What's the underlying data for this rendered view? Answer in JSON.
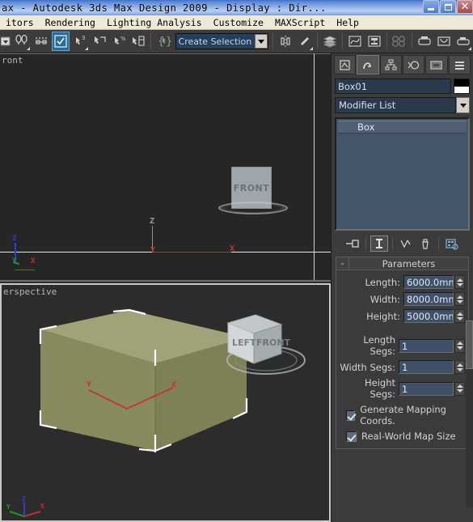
{
  "titlebar": {
    "title": "ax        - Autodesk 3ds Max Design 2009        - Display : Dir...",
    "minimize_label": "Minimize",
    "maximize_label": "Restore",
    "close_label": "Close"
  },
  "menubar": {
    "items": [
      {
        "label": "itors"
      },
      {
        "label": "Rendering"
      },
      {
        "label": "Lighting Analysis"
      },
      {
        "label": "Customize"
      },
      {
        "label": "MAXScript"
      },
      {
        "label": "Help"
      }
    ]
  },
  "toolbar": {
    "selection_set": {
      "value": "Create Selection Set",
      "placeholder": "Create Selection Set"
    },
    "buttons": [
      {
        "name": "undo-dropdown-icon",
        "glyph": "▾"
      },
      {
        "name": "select-and-link-icon",
        "glyph": "⛓"
      },
      {
        "name": "bind-to-space-warp-icon",
        "glyph": "⚙"
      },
      {
        "name": "select-object-icon",
        "glyph": "▣"
      },
      {
        "name": "select-by-name-icon",
        "glyph": "⬚"
      },
      {
        "name": "rectangular-selection-region-icon",
        "glyph": "⬛"
      },
      {
        "name": "window-crossing-icon",
        "glyph": "⬜"
      },
      {
        "name": "select-and-move-icon",
        "glyph": "✥"
      },
      {
        "name": "selection-filter-icon",
        "glyph": "◈"
      },
      {
        "name": "mirror-icon",
        "glyph": "⬌"
      },
      {
        "name": "align-icon",
        "glyph": "⬚"
      },
      {
        "name": "layer-manager-icon",
        "glyph": "☰"
      },
      {
        "name": "curve-editor-icon",
        "glyph": "∿"
      },
      {
        "name": "schematic-view-icon",
        "glyph": "⊞"
      },
      {
        "name": "material-editor-icon",
        "glyph": "◌"
      },
      {
        "name": "render-setup-icon",
        "glyph": "⬛"
      },
      {
        "name": "rendered-frame-window-icon",
        "glyph": "◑"
      },
      {
        "name": "render-production-icon",
        "glyph": "▤"
      }
    ]
  },
  "viewports": {
    "top": {
      "label": "ront",
      "viewcube_face": "FRONT",
      "axis_labels": {
        "z": "Z",
        "y": "Y",
        "x": "X"
      },
      "gizmo_labels": {
        "z": "Z",
        "y": "Y",
        "x": "X"
      }
    },
    "bottom": {
      "label": "erspective",
      "viewcube_faces": {
        "left": "LEFT",
        "front": "FRONT"
      },
      "axis_labels": {
        "z": "Z",
        "y": "Y",
        "x": "X"
      },
      "gizmo_labels": {
        "y": "Y",
        "x": "X"
      },
      "object_color": "#8e9162"
    }
  },
  "command_panel": {
    "tabs": [
      {
        "name": "create-tab",
        "label": "Create"
      },
      {
        "name": "modify-tab",
        "label": "Modify"
      },
      {
        "name": "hierarchy-tab",
        "label": "Hierarchy"
      },
      {
        "name": "motion-tab",
        "label": "Motion"
      },
      {
        "name": "display-tab",
        "label": "Display"
      },
      {
        "name": "utilities-tab",
        "label": "Utilities"
      }
    ],
    "object_name": "Box01",
    "object_color": "#000000",
    "modifier_list_label": "Modifier List",
    "modifier_stack": [
      {
        "label": "Box"
      }
    ],
    "stack_tools": [
      {
        "name": "pin-stack-icon",
        "label": "Pin Stack"
      },
      {
        "name": "show-end-result-icon",
        "label": "Show End Result"
      },
      {
        "name": "make-unique-icon",
        "label": "Make Unique"
      },
      {
        "name": "remove-modifier-icon",
        "label": "Remove Modifier"
      },
      {
        "name": "configure-modifier-sets-icon",
        "label": "Configure Modifier Sets"
      }
    ],
    "parameters": {
      "title": "Parameters",
      "collapse_glyph": "-",
      "fields": [
        {
          "label": "Length:",
          "value": "6000.0mm"
        },
        {
          "label": "Width:",
          "value": "8000.0mm"
        },
        {
          "label": "Height:",
          "value": "5000.0mm"
        },
        {
          "label": "Length Segs:",
          "value": "1"
        },
        {
          "label": "Width Segs:",
          "value": "1"
        },
        {
          "label": "Height Segs:",
          "value": "1"
        }
      ],
      "checkboxes": [
        {
          "label": "Generate Mapping Coords.",
          "checked": true
        },
        {
          "label": "Real-World Map Size",
          "checked": true
        }
      ]
    }
  }
}
